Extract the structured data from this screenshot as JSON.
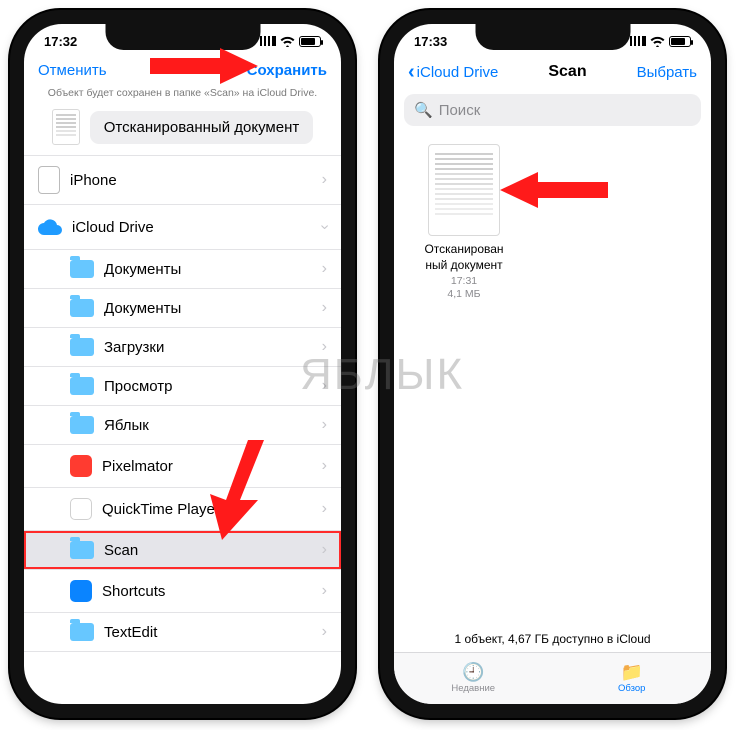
{
  "watermark": "ЯБЛЫК",
  "left": {
    "status_time": "17:32",
    "nav": {
      "cancel": "Отменить",
      "save": "Сохранить"
    },
    "subtitle": "Объект будет сохранен в папке «Scan» на iCloud Drive.",
    "filename": "Отсканированный документ",
    "list": {
      "iphone": "iPhone",
      "icloud": "iCloud Drive",
      "folders": [
        "Документы",
        "Документы",
        "Загрузки",
        "Просмотр",
        "Яблык"
      ],
      "apps": {
        "pixelmator": "Pixelmator",
        "quicktime": "QuickTime Player",
        "scan": "Scan",
        "shortcuts": "Shortcuts",
        "textedit": "TextEdit"
      }
    }
  },
  "right": {
    "status_time": "17:33",
    "nav": {
      "back": "iCloud Drive",
      "title": "Scan",
      "select": "Выбрать"
    },
    "search_placeholder": "Поиск",
    "file": {
      "name_l1": "Отсканирован",
      "name_l2": "ный документ",
      "time": "17:31",
      "size": "4,1 МБ"
    },
    "footer": "1 объект, 4,67 ГБ доступно в iCloud",
    "tabs": {
      "recent": "Недавние",
      "browse": "Обзор"
    }
  }
}
